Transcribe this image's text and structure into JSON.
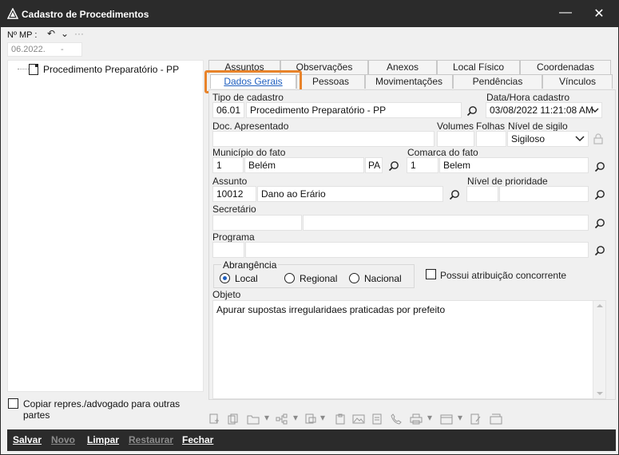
{
  "window": {
    "title": "Cadastro de Procedimentos",
    "minimize_symbol": "—",
    "close_symbol": "✕"
  },
  "toolbar": {
    "mp_label": "Nº MP :",
    "mp_value": "06.2022.",
    "mp_suffix": "-",
    "undo_icon": "↶",
    "redo_icon": "⌄",
    "more_icon": "···"
  },
  "tree": {
    "items": [
      {
        "label": "Procedimento Preparatório - PP"
      }
    ]
  },
  "copy_checkbox": {
    "label": "Copiar repres./advogado para outras partes",
    "checked": false
  },
  "tabs": {
    "row1": [
      {
        "label": "Assuntos"
      },
      {
        "label": "Observações"
      },
      {
        "label": "Anexos"
      },
      {
        "label": "Local Físico"
      },
      {
        "label": "Coordenadas"
      }
    ],
    "row2": [
      {
        "label": "Dados Gerais",
        "active": true
      },
      {
        "label": "Pessoas"
      },
      {
        "label": "Movimentações"
      },
      {
        "label": "Pendências"
      },
      {
        "label": "Vínculos"
      }
    ]
  },
  "form": {
    "tipo_cadastro": {
      "label": "Tipo de cadastro",
      "code": "06.01",
      "value": "Procedimento Preparatório - PP"
    },
    "data_hora": {
      "label": "Data/Hora cadastro",
      "value": "03/08/2022 11:21:08 AM"
    },
    "doc_apresentado": {
      "label": "Doc. Apresentado",
      "value": ""
    },
    "volumes": {
      "label": "Volumes",
      "value": ""
    },
    "folhas": {
      "label": "Folhas",
      "value": ""
    },
    "nivel_sigilo": {
      "label": "Nível de sigilo",
      "value": "Sigiloso"
    },
    "municipio": {
      "label": "Município do fato",
      "code": "1",
      "value": "Belém",
      "uf": "PA"
    },
    "comarca": {
      "label": "Comarca do fato",
      "code": "1",
      "value": "Belem"
    },
    "assunto": {
      "label": "Assunto",
      "code": "10012",
      "value": "Dano ao Erário"
    },
    "nivel_prioridade": {
      "label": "Nível de prioridade",
      "code": "",
      "value": ""
    },
    "secretario": {
      "label": "Secretário",
      "code": "",
      "value": ""
    },
    "programa": {
      "label": "Programa",
      "code": "",
      "value": ""
    },
    "abrangencia": {
      "label": "Abrangência",
      "options": [
        {
          "label": "Local",
          "checked": true
        },
        {
          "label": "Regional",
          "checked": false
        },
        {
          "label": "Nacional",
          "checked": false
        }
      ]
    },
    "atribuicao": {
      "label": "Possui atribuição concorrente",
      "checked": false
    },
    "objeto": {
      "label": "Objeto",
      "value": "Apurar supostas irregularidaes praticadas por prefeito"
    }
  },
  "bottom": {
    "buttons": [
      {
        "label": "Salvar",
        "enabled": true
      },
      {
        "label": "Novo",
        "enabled": false
      },
      {
        "label": "Limpar",
        "enabled": true
      },
      {
        "label": "Restaurar",
        "enabled": false
      },
      {
        "label": "Fechar",
        "enabled": true
      }
    ]
  },
  "colors": {
    "titlebar": "#2b2b2b",
    "active_tab_text": "#1f5fbf",
    "highlight": "#e8832a"
  }
}
